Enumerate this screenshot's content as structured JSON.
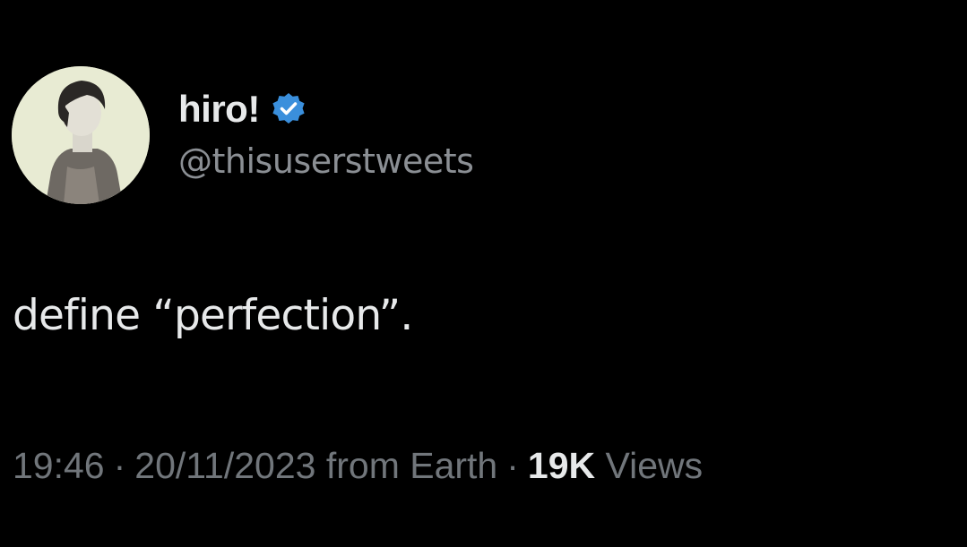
{
  "tweet": {
    "author": {
      "display_name": "hiro!",
      "handle": "@thisuserstweets",
      "verified": true,
      "verified_icon": "verified-badge-icon",
      "badge_color": "#1d9bf0"
    },
    "text": "define “perfection”.",
    "meta": {
      "time": "19:46",
      "separator": "·",
      "date": "20/11/2023",
      "source": "from Earth",
      "views_count": "19K",
      "views_label": "Views"
    }
  }
}
